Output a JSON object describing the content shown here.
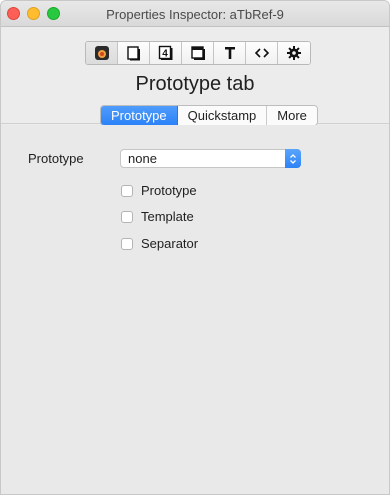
{
  "window": {
    "title": "Properties Inspector: aTbRef-9"
  },
  "toolbar": {
    "tools": [
      {
        "icon": "note-icon"
      },
      {
        "icon": "page-icon"
      },
      {
        "icon": "number-4-icon"
      },
      {
        "icon": "window-icon"
      },
      {
        "icon": "text-T-icon"
      },
      {
        "icon": "code-brackets-icon"
      },
      {
        "icon": "gear-icon"
      }
    ]
  },
  "tab_heading": "Prototype tab",
  "tabs": {
    "prototype": "Prototype",
    "quickstamp": "Quickstamp",
    "more": "More",
    "selected": "Prototype"
  },
  "prototype_field": {
    "label": "Prototype",
    "value": "none"
  },
  "checkboxes": [
    {
      "label": "Prototype",
      "checked": false
    },
    {
      "label": "Template",
      "checked": false
    },
    {
      "label": "Separator",
      "checked": false
    }
  ],
  "colors": {
    "accent": "#2c82f7",
    "close": "#fd5f57",
    "minimize": "#febc2e",
    "maximize": "#28c840"
  }
}
